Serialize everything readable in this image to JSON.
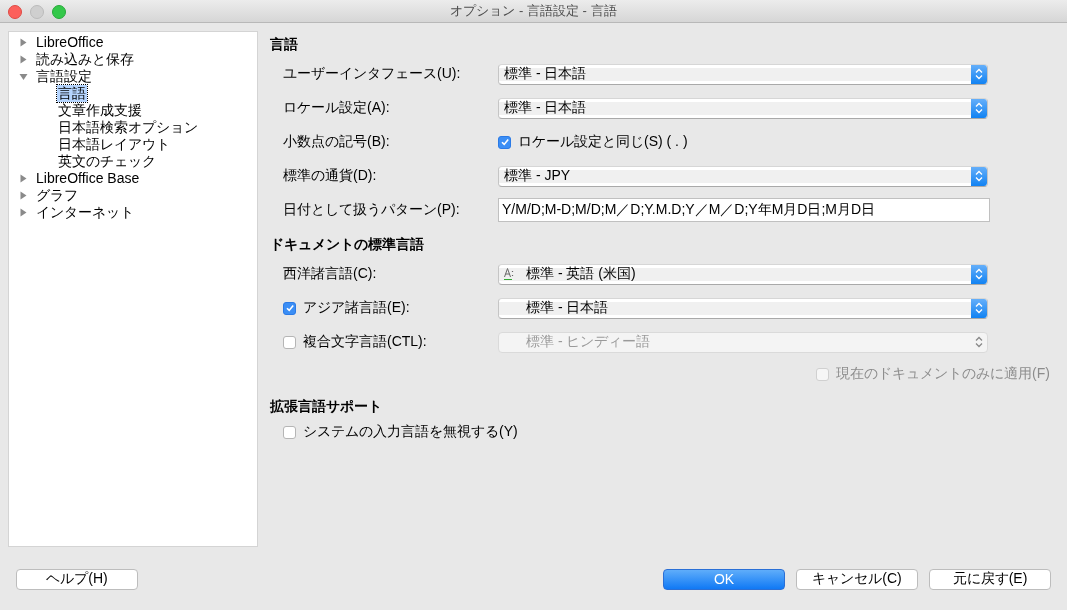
{
  "window": {
    "title": "オプション - 言語設定 - 言語"
  },
  "tree": [
    {
      "label": "LibreOffice",
      "expanded": false,
      "selected": false
    },
    {
      "label": "読み込みと保存",
      "expanded": false,
      "selected": false
    },
    {
      "label": "言語設定",
      "expanded": true,
      "selected": false,
      "children": [
        {
          "label": "言語",
          "selected": true
        },
        {
          "label": "文章作成支援",
          "selected": false
        },
        {
          "label": "日本語検索オプション",
          "selected": false
        },
        {
          "label": "日本語レイアウト",
          "selected": false
        },
        {
          "label": "英文のチェック",
          "selected": false
        }
      ]
    },
    {
      "label": "LibreOffice Base",
      "expanded": false,
      "selected": false
    },
    {
      "label": "グラフ",
      "expanded": false,
      "selected": false
    },
    {
      "label": "インターネット",
      "expanded": false,
      "selected": false
    }
  ],
  "sections": [
    {
      "heading": "言語",
      "rows": [
        {
          "kind": "select",
          "label": "ユーザーインタフェース(U):",
          "value": "標準 - 日本語",
          "disabled": false
        },
        {
          "kind": "select",
          "label": "ロケール設定(A):",
          "value": "標準 - 日本語",
          "disabled": false
        },
        {
          "kind": "option",
          "label": "小数点の記号(B):",
          "option": {
            "label": "ロケール設定と同じ(S) ( . )",
            "checked": true
          }
        },
        {
          "kind": "select",
          "label": "標準の通貨(D):",
          "value": "標準 - JPY",
          "disabled": false
        },
        {
          "kind": "text",
          "label": "日付として扱うパターン(P):",
          "value": "Y/M/D;M-D;M/D;M／D;Y.M.D;Y／M／D;Y年M月D日;M月D日"
        }
      ]
    },
    {
      "heading": "ドキュメントの標準言語",
      "rows": [
        {
          "kind": "iconselect",
          "label": "西洋諸言語(C):",
          "value": "標準 - 英語 (米国)",
          "disabled": false
        },
        {
          "kind": "checkselect",
          "label": "アジア諸言語(E):",
          "checked": true,
          "value": "標準 - 日本語",
          "disabled": false
        },
        {
          "kind": "checkselect",
          "label": "複合文字言語(CTL):",
          "checked": false,
          "value": "標準 - ヒンディー語",
          "disabled": true
        },
        {
          "kind": "rightcheck",
          "label": "現在のドキュメントのみに適用(F)",
          "checked": false,
          "disabled": true
        }
      ]
    },
    {
      "heading": "拡張言語サポート",
      "rows": [
        {
          "kind": "check",
          "label": "システムの入力言語を無視する(Y)",
          "checked": false,
          "disabled": false
        }
      ]
    }
  ],
  "buttons": [
    {
      "label": "ヘルプ(H)",
      "default": false
    },
    {
      "label": "OK",
      "default": true
    },
    {
      "label": "キャンセル(C)",
      "default": false
    },
    {
      "label": "元に戻す(E)",
      "default": false
    }
  ]
}
